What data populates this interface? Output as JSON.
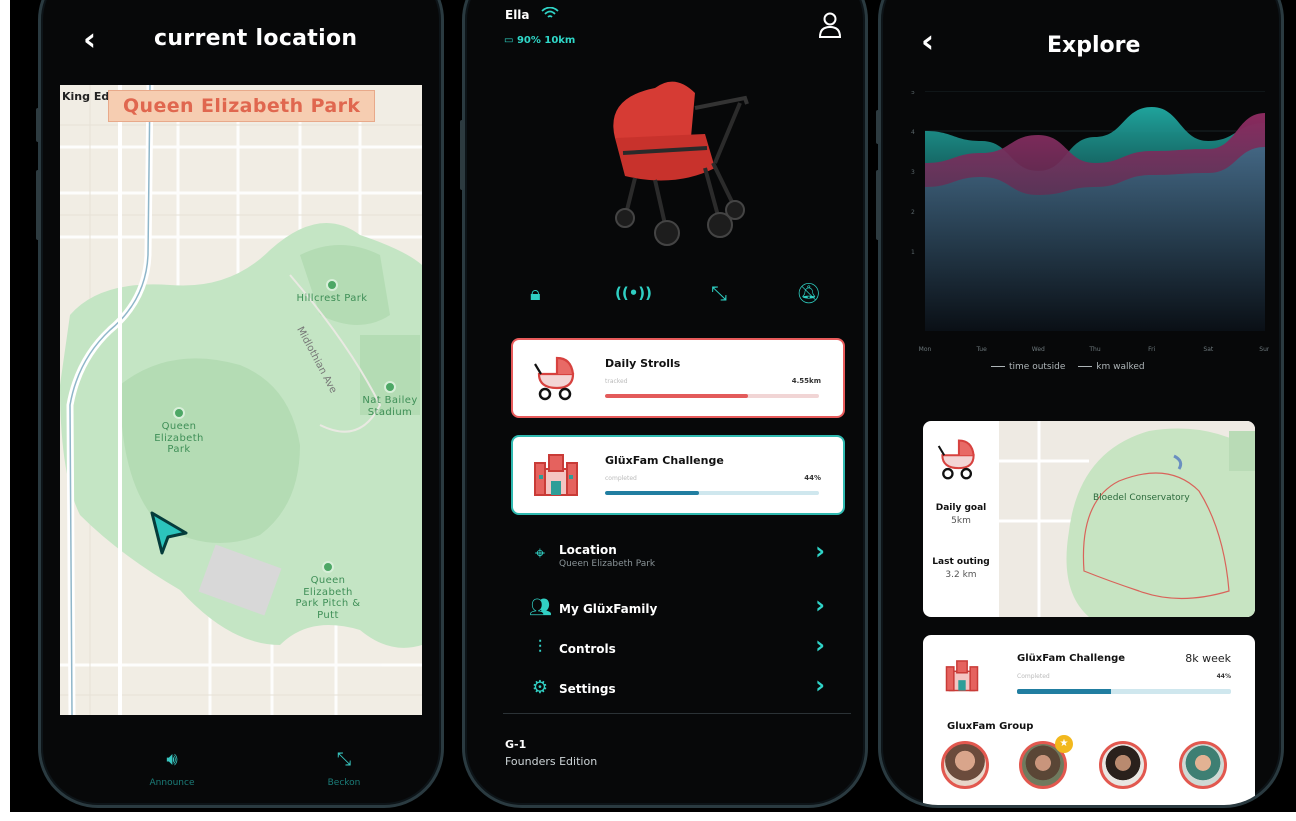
{
  "screen1": {
    "title": "current location",
    "map": {
      "corner_label": "King Ed",
      "location_chip": "Queen Elizabeth Park",
      "pois": [
        "Hillcrest Park",
        "Nat Bailey Stadium",
        "Queen Elizabeth Park",
        "Queen Elizabeth Park Pitch & Putt"
      ],
      "road": "Midlothian Ave"
    },
    "bottom_actions": [
      {
        "label": "Announce",
        "icon": "speaker-icon"
      },
      {
        "label": "Beckon",
        "icon": "collapse-icon"
      }
    ]
  },
  "screen2": {
    "name": "Ella",
    "battery_status": "90% 10km",
    "quick_icons": [
      "lock-icon",
      "signal-icon",
      "collapse-icon",
      "bell-off-icon"
    ],
    "cards": [
      {
        "title": "Daily Strolls",
        "subtitle": "tracked",
        "value": "4.55km",
        "progress": 0.67,
        "color": "#e35b5b",
        "icon": "stroller-icon"
      },
      {
        "title": "GlüxFam Challenge",
        "subtitle": "completed",
        "value": "44%",
        "progress": 0.44,
        "color": "#217ea1",
        "icon": "castle-icon"
      }
    ],
    "menu": [
      {
        "label": "Location",
        "sublabel": "Queen Elizabeth Park",
        "icon": "location-pin-icon"
      },
      {
        "label": "My GlüxFamily",
        "sublabel": "",
        "icon": "people-icon"
      },
      {
        "label": "Controls",
        "sublabel": "",
        "icon": "sliders-icon"
      },
      {
        "label": "Settings",
        "sublabel": "",
        "icon": "gear-icon"
      }
    ],
    "model": "G-1",
    "edition": "Founders Edition"
  },
  "screen3": {
    "title": "Explore",
    "chart_data": {
      "type": "area",
      "categories": [
        "Mon",
        "Tue",
        "Wed",
        "Thu",
        "Fri",
        "Sat",
        "Sun"
      ],
      "series": [
        {
          "name": "time outside",
          "values": [
            4.0,
            3.75,
            3.0,
            3.85,
            4.6,
            3.75,
            4.2
          ],
          "color": "#1f8f8c"
        },
        {
          "name": "km walked",
          "values": [
            3.2,
            3.45,
            3.9,
            3.2,
            3.5,
            3.55,
            4.45
          ],
          "color": "#7a2354"
        }
      ],
      "ylim": [
        0,
        5
      ],
      "yticks": [
        "1",
        "2",
        "3",
        "4",
        "5"
      ]
    },
    "walk_card": {
      "goal_label": "Daily goal",
      "goal_value": "5km",
      "last_label": "Last outing",
      "last_value": "3.2 km",
      "map_label": "Bloedel Conservatory"
    },
    "challenge": {
      "title": "GlüxFam Challenge",
      "period": "8k week",
      "subtitle": "Completed",
      "value": "44%",
      "progress": 0.44,
      "group_label": "GluxFam Group",
      "badge": "★"
    }
  }
}
